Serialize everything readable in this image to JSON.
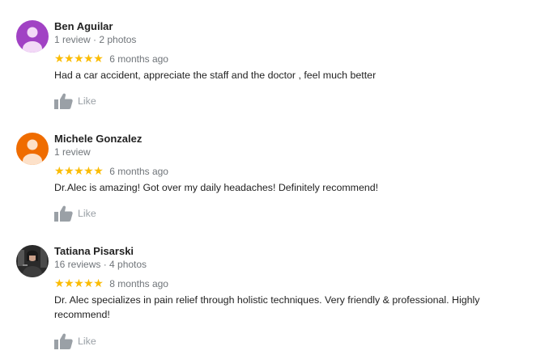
{
  "reviews": [
    {
      "name": "Ben Aguilar",
      "meta": "1 review · 2 photos",
      "stars": "★★★★★",
      "time": "6 months ago",
      "text": "Had a car accident, appreciate the staff and the doctor , feel much better",
      "like_label": "Like",
      "avatar_color": "#a142c4"
    },
    {
      "name": "Michele Gonzalez",
      "meta": "1 review",
      "stars": "★★★★★",
      "time": "6 months ago",
      "text": "Dr.Alec is amazing! Got over my daily headaches! Definitely recommend!",
      "like_label": "Like",
      "avatar_color": "#ef6c00"
    },
    {
      "name": "Tatiana Pisarski",
      "meta": "16 reviews · 4 photos",
      "stars": "★★★★★",
      "time": "8 months ago",
      "text": "Dr. Alec specializes in pain relief through holistic techniques. Very friendly & professional. Highly recommend!",
      "like_label": "Like",
      "avatar_color": "#2a2a2a"
    }
  ],
  "colors": {
    "star": "#fbbc04",
    "muted": "#70757a",
    "like": "#9aa0a6"
  }
}
